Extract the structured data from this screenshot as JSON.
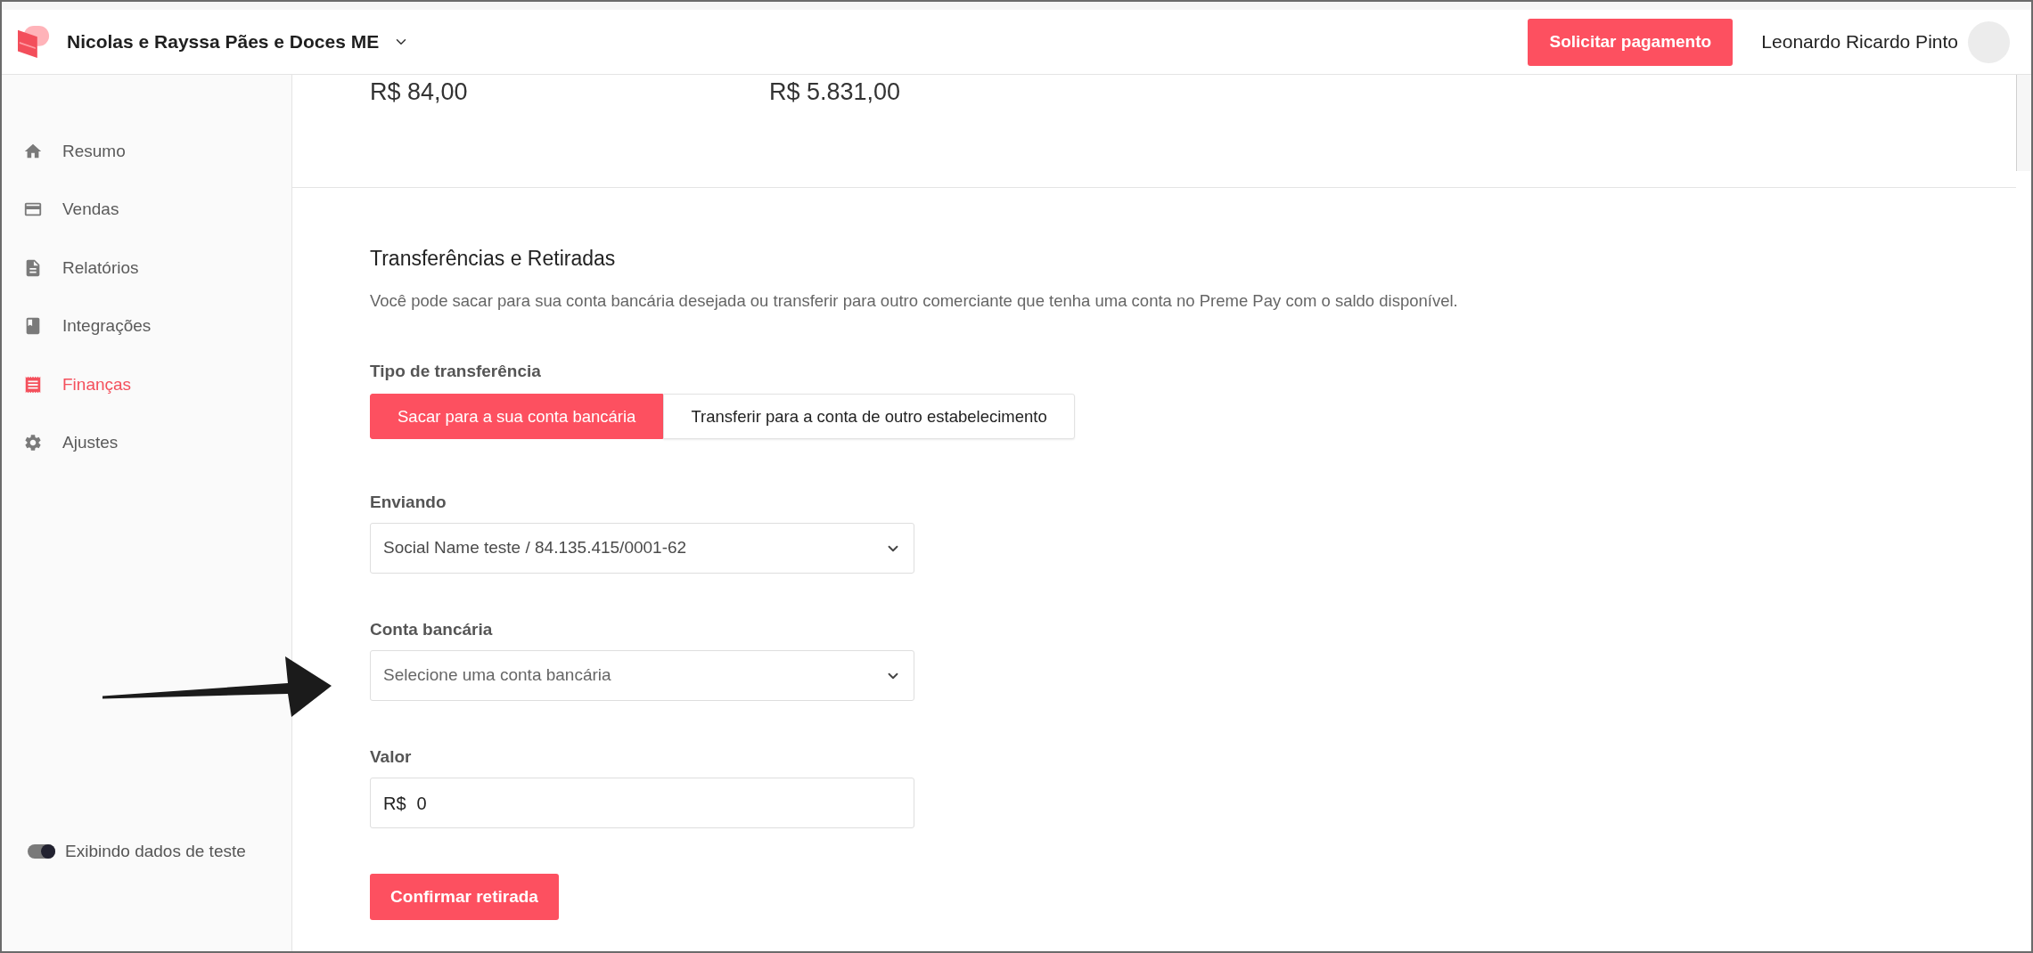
{
  "header": {
    "company": "Nicolas e Rayssa Pães e Doces ME",
    "action_button": "Solicitar pagamento",
    "user_name": "Leonardo Ricardo Pinto"
  },
  "sidebar": {
    "items": [
      {
        "label": "Resumo",
        "selected": false
      },
      {
        "label": "Vendas",
        "selected": false
      },
      {
        "label": "Relatórios",
        "selected": false
      },
      {
        "label": "Integrações",
        "selected": false
      },
      {
        "label": "Finanças",
        "selected": true
      },
      {
        "label": "Ajustes",
        "selected": false
      }
    ],
    "test_toggle": {
      "label": "Exibindo dados de teste",
      "on": true
    }
  },
  "balances": [
    {
      "value": "R$ 84,00"
    },
    {
      "value": "R$ 5.831,00"
    }
  ],
  "transfer": {
    "title": "Transferências e Retiradas",
    "description": "Você pode sacar para sua conta bancária desejada ou transferir para outro comerciante que tenha uma conta no Preme Pay com o saldo disponível.",
    "type_label": "Tipo de transferência",
    "types": [
      {
        "label": "Sacar para a sua conta bancária",
        "selected": true
      },
      {
        "label": "Transferir para a conta de outro estabelecimento",
        "selected": false
      }
    ],
    "fields": [
      {
        "kind": "select",
        "label": "Enviando",
        "value": "Social Name teste / 84.135.415/0001-62"
      },
      {
        "kind": "select",
        "label": "Conta bancária",
        "placeholder": "Selecione uma conta bancária"
      },
      {
        "kind": "currency",
        "label": "Valor",
        "prefix": "R$",
        "value": "0"
      }
    ],
    "submit": "Confirmar retirada"
  }
}
